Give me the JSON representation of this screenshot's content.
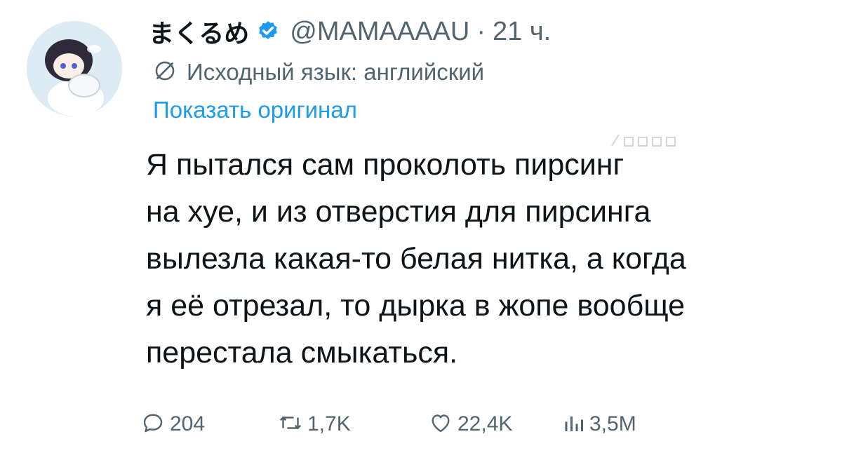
{
  "tweet": {
    "display_name": "まくるめ",
    "handle": "@MAMAAAAU",
    "separator": "·",
    "time": "21 ч.",
    "translation_note": "Исходный язык: английский",
    "show_original": "Показать оригинал",
    "text_lines": [
      "Я пытался сам проколоть пирсинг",
      "на хуе, и из отверстия для пирсинга",
      "вылезла какая-то белая нитка, а когда",
      "я её отрезал, то дырка в жопе вообще",
      "перестала смыкаться."
    ],
    "stats": {
      "replies": "204",
      "retweets": "1,7K",
      "likes": "22,4K",
      "views": "3,5M"
    }
  },
  "icons": {
    "verified": "verified-badge-icon",
    "translate": "translate-globe-icon",
    "reply": "reply-icon",
    "retweet": "retweet-icon",
    "like": "heart-icon",
    "views": "views-bar-chart-icon"
  },
  "colors": {
    "accent": "#1d9bf0",
    "muted": "#536471",
    "text": "#0f1419"
  }
}
